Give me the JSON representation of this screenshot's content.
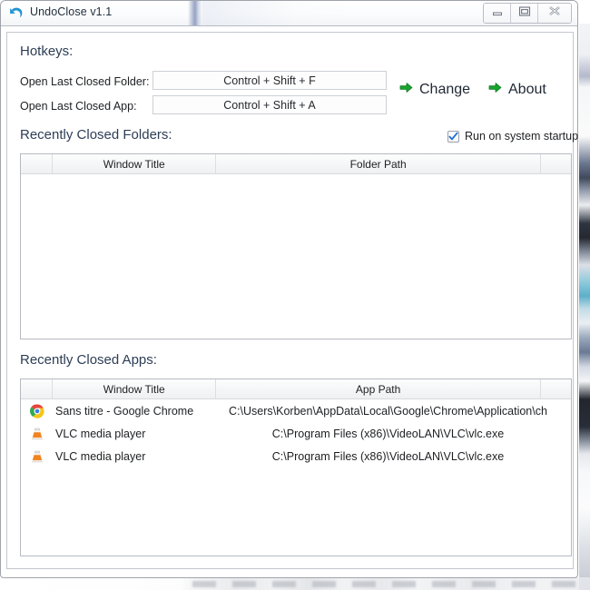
{
  "window": {
    "title": "UndoClose v1.1",
    "app_icon": "undo-arrow-icon",
    "controls": {
      "minimize": "minimize-icon",
      "maximize": "maximize-icon",
      "close": "close-icon"
    }
  },
  "hotkeys": {
    "heading": "Hotkeys:",
    "fields": [
      {
        "label": "Open Last Closed Folder:",
        "value": "Control + Shift + F"
      },
      {
        "label": "Open Last Closed App:",
        "value": "Control + Shift + A"
      }
    ],
    "change_label": "Change",
    "about_label": "About",
    "arrow_icon": "green-arrow-right-icon"
  },
  "startup": {
    "label": "Run on system startup",
    "checked": true
  },
  "folders": {
    "heading": "Recently Closed Folders:",
    "columns": [
      "",
      "Window Title",
      "Folder Path",
      ""
    ],
    "rows": []
  },
  "apps": {
    "heading": "Recently Closed Apps:",
    "columns": [
      "",
      "Window Title",
      "App Path",
      ""
    ],
    "rows": [
      {
        "icon": "chrome-icon",
        "title": "Sans titre - Google Chrome",
        "path": "C:\\Users\\Korben\\AppData\\Local\\Google\\Chrome\\Application\\ch"
      },
      {
        "icon": "vlc-icon",
        "title": "VLC media player",
        "path": "C:\\Program Files (x86)\\VideoLAN\\VLC\\vlc.exe"
      },
      {
        "icon": "vlc-icon",
        "title": "VLC media player",
        "path": "C:\\Program Files (x86)\\VideoLAN\\VLC\\vlc.exe"
      }
    ]
  },
  "colors": {
    "heading": "#2d3e56",
    "accent_green": "#159a2e",
    "check_blue": "#1f6fd0",
    "title_text": "#22303f"
  }
}
